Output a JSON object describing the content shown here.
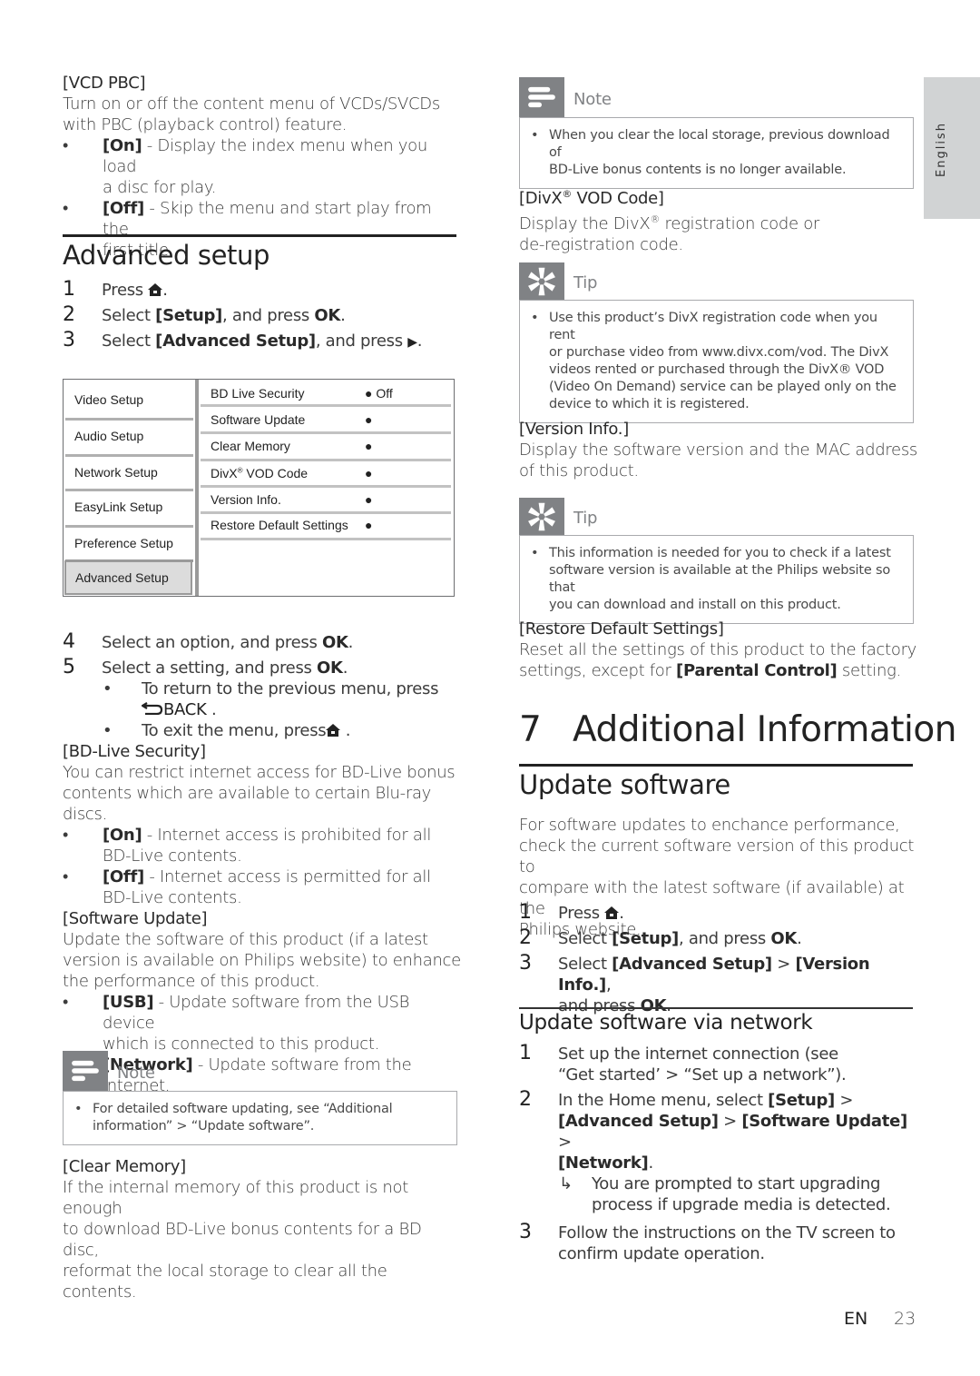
{
  "side_tab": {
    "label": "English"
  },
  "left": {
    "vcd_pbc": {
      "term": "[VCD PBC]",
      "desc_lines": [
        "Turn on or off the content menu of VCDs/SVCDs",
        "with PBC (playback control) feature."
      ],
      "bullets": [
        {
          "key": "[On]",
          "text": " - Display the index menu when you load",
          "cont": "a disc for play."
        },
        {
          "key": "[Off]",
          "text": " - Skip the menu and start play from the",
          "cont": "first title."
        }
      ]
    },
    "advanced_setup": {
      "heading": "Advanced setup",
      "steps": [
        {
          "num": "1",
          "pre": "Press ",
          "icon": "home-icon",
          "post": "."
        },
        {
          "num": "2",
          "pre": "Select ",
          "bold1": "[Setup]",
          "mid": ", and press ",
          "bold2": "OK",
          "post": "."
        },
        {
          "num": "3",
          "pre": "Select ",
          "bold1": "[Advanced Setup]",
          "mid": ", and press ",
          "icon": "play-right-icon",
          "post": "."
        }
      ]
    },
    "menu": {
      "left_items": [
        "Video Setup",
        "Audio Setup",
        "Network Setup",
        "EasyLink Setup",
        "Preference Setup",
        "Advanced Setup"
      ],
      "active_item": "Advanced Setup",
      "right_items": [
        {
          "label": "BD Live Security",
          "value": "Off"
        },
        {
          "label": "Software Update",
          "value": ""
        },
        {
          "label": "Clear Memory",
          "value": ""
        },
        {
          "label": "DivX",
          "sup": "®",
          "label_rest": " VOD Code",
          "value": ""
        },
        {
          "label": "Version Info.",
          "value": ""
        },
        {
          "label": "Restore Default Settings",
          "value": ""
        }
      ]
    },
    "steps2": [
      {
        "num": "4",
        "pre": "Select an option, and press ",
        "bold": "OK",
        "post": "."
      },
      {
        "num": "5",
        "pre": "Select a setting, and press ",
        "bold": "OK",
        "post": "."
      }
    ],
    "sub_bullets": {
      "return_line1": "To return to the previous menu, press",
      "back_label": "BACK",
      "back_post": " .",
      "exit_pre": "To exit the menu, press",
      "exit_post": " ."
    },
    "bd_live": {
      "term": "[BD-Live Security]",
      "desc_lines": [
        "You can restrict internet access for BD-Live bonus",
        "contents which are available to certain Blu-ray discs."
      ],
      "bullets": [
        {
          "key": "[On]",
          "text": " - Internet access is prohibited for all",
          "cont": "BD-Live contents."
        },
        {
          "key": "[Off]",
          "text": " - Internet access is permitted for all",
          "cont": "BD-Live contents."
        }
      ]
    },
    "software_update": {
      "term": "[Software Update]",
      "desc_lines": [
        "Update the software of this product (if a latest",
        "version is available on Philips website) to enhance",
        "the performance of this product."
      ],
      "bullets": [
        {
          "key": "[USB]",
          "text": " - Update software from the USB device",
          "cont": "which is connected to this product."
        },
        {
          "key": "[Network]",
          "text": " - Update software from the internet.",
          "cont": ""
        }
      ]
    },
    "note": {
      "label": "Note",
      "lines": [
        "For detailed software updating, see “Additional",
        "information” > “Update software”."
      ]
    },
    "clear_memory": {
      "term": "[Clear Memory]",
      "desc_lines": [
        "If the internal memory of this product is not enough",
        "to download BD-Live bonus contents for a BD disc,",
        "reformat the local storage to clear all the contents."
      ]
    }
  },
  "right": {
    "note": {
      "label": "Note",
      "lines": [
        "When you clear the local storage, previous download of",
        "BD-Live bonus contents is no longer available."
      ]
    },
    "divx": {
      "term_pre": "[DivX",
      "term_sup": "®",
      "term_post": " VOD Code]",
      "desc_pre": "Display the DivX",
      "desc_sup": "®",
      "desc_post": " registration code or",
      "desc_line2": "de-registration code."
    },
    "tip1": {
      "label": "Tip",
      "lines": [
        "Use this product’s DivX registration code when you rent",
        "or purchase video from www.divx.com/vod. The DivX",
        "videos rented or purchased through the DivX® VOD",
        "(Video On Demand) service can be played only on the",
        "device to which it is registered."
      ]
    },
    "version_info": {
      "term": "[Version Info.]",
      "desc_lines": [
        "Display the software version and the MAC address",
        "of this product."
      ]
    },
    "tip2": {
      "label": "Tip",
      "lines": [
        "This information is needed for you to check if a latest",
        "software version is available at the Philips website so that",
        "you can download and install on this product."
      ]
    },
    "restore": {
      "term": "[Restore Default Settings]",
      "desc_line1": "Reset all the settings of this product to the factory",
      "desc_pre2": "settings, except for ",
      "desc_bold2": "[Parental Control]",
      "desc_post2": " setting."
    },
    "chapter": {
      "num": "7",
      "title": "Additional Information"
    },
    "update_software": {
      "heading": "Update software",
      "intro_lines": [
        "For software updates to enchance performance,",
        "check the current software version of this product to",
        "compare with the latest software (if available) at the",
        "Philips website."
      ],
      "steps": [
        {
          "num": "1",
          "pre": "Press ",
          "post": "."
        },
        {
          "num": "2",
          "pre": "Select ",
          "bold1": "[Setup]",
          "mid": ", and press ",
          "bold2": "OK",
          "post": "."
        },
        {
          "num": "3",
          "pre": "Select ",
          "bold1": "[Advanced Setup]",
          "mid": " > ",
          "bold2": "[Version Info.]",
          "post": ",",
          "line2_pre": "and press ",
          "line2_bold": "OK",
          "line2_post": "."
        }
      ]
    },
    "via_network": {
      "heading": "Update software via network",
      "step1_line1": "Set up the internet connection (see",
      "step1_line2": "“Get started’ > “Set up a network”).",
      "step2_pre": "In the Home menu, select ",
      "step2_b1": "[Setup]",
      "step2_gt1": " >",
      "step2_b2": "[Advanced Setup]",
      "step2_gt2": " > ",
      "step2_b3": "[Software Update]",
      "step2_gt3": " >",
      "step2_b4": "[Network]",
      "step2_post": ".",
      "result_line1": "You are prompted to start upgrading",
      "result_line2": "process if upgrade media is detected.",
      "step3_line1": "Follow the instructions on the TV screen to",
      "step3_line2": "confirm update operation."
    }
  },
  "footer": {
    "lang": "EN",
    "page": "23"
  }
}
